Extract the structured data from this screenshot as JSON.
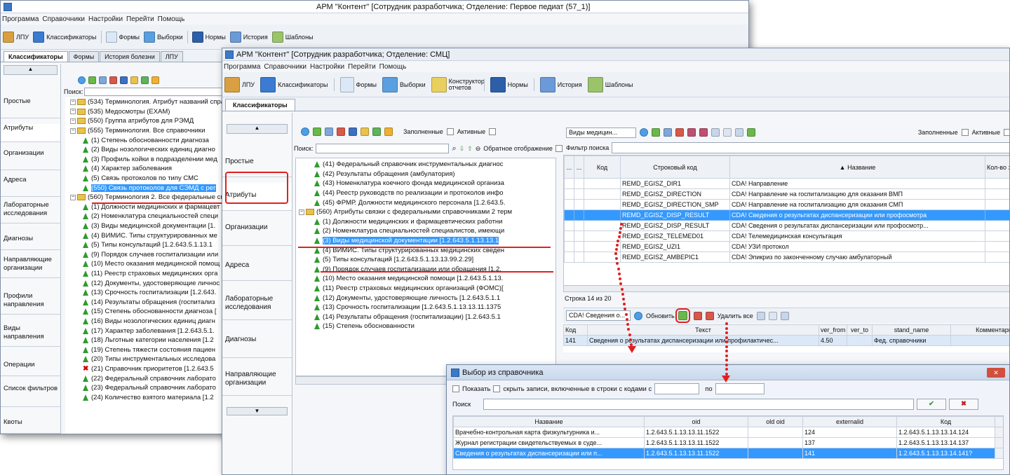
{
  "back_window": {
    "title": "АРМ \"Контент\" [Сотрудник разработчика; Отделение: Первое педиат (57_1)]",
    "menu": [
      "Программа",
      "Справочники",
      "Настройки",
      "Перейти",
      "Помощь"
    ],
    "toolbar": [
      "ЛПУ",
      "Классификаторы",
      "Формы",
      "Выборки",
      "Нормы",
      "История",
      "Шаблоны"
    ],
    "tabs": [
      "Классификаторы",
      "Формы",
      "История болезни",
      "ЛПУ"
    ],
    "search_label": "Поиск:",
    "sidebar": [
      "Простые",
      "Атрибуты",
      "Организации",
      "Адреса",
      "Лабораторные исследования",
      "Диагнозы",
      "Направляющие организации",
      "Профили направления",
      "Виды направления",
      "Операции",
      "Список фильтров",
      "Квоты"
    ],
    "tree": [
      {
        "t": "(534) Терминология. Атрибут названий спра",
        "k": "folder"
      },
      {
        "t": "(535) Медосмотры (EXAM)",
        "k": "folder"
      },
      {
        "t": "(550) Группа атрибутов для РЭМД",
        "k": "folder"
      },
      {
        "t": "(555) Терминология. Все справочники",
        "k": "folder"
      },
      {
        "t": "(1) Степень обоснованности диагноза",
        "k": "leaf"
      },
      {
        "t": "(2) Виды нозологических единиц диагно",
        "k": "leaf"
      },
      {
        "t": "(3) Профиль койки в подразделении мед",
        "k": "leaf"
      },
      {
        "t": "(4) Характер заболевания",
        "k": "leaf"
      },
      {
        "t": "(5) Связь протоколов по типу СМС",
        "k": "leaf"
      },
      {
        "t": "(550) Связь протоколов для СЭМД с рег",
        "k": "sel"
      },
      {
        "t": "(560) Терминология 2. Все федеральные спр",
        "k": "folder"
      },
      {
        "t": "(1) Должности медицинских и фармацевт",
        "k": "leaf"
      },
      {
        "t": "(2) Номенклатура специальностей специ",
        "k": "leaf"
      },
      {
        "t": "(3) Виды медицинской документации [1.",
        "k": "leaf"
      },
      {
        "t": "(4) ВИМИС. Типы структурированных ме",
        "k": "leaf"
      },
      {
        "t": "(5) Типы консультаций [1.2.643.5.1.13.1",
        "k": "leaf"
      },
      {
        "t": "(9) Порядок случаев госпитализации или",
        "k": "leaf"
      },
      {
        "t": "(10) Место оказания медицинской помощ",
        "k": "leaf"
      },
      {
        "t": "(11) Реестр страховых медицинских орга",
        "k": "leaf"
      },
      {
        "t": "(12) Документы, удостоверяющие личнос",
        "k": "leaf"
      },
      {
        "t": "(13) Срочность госпитализации [1.2.643.",
        "k": "leaf"
      },
      {
        "t": "(14) Результаты обращения (госпитализ",
        "k": "leaf"
      },
      {
        "t": "(15) Степень обоснованности диагноза [",
        "k": "leaf"
      },
      {
        "t": "(16) Виды нозологических единиц диагн",
        "k": "leaf"
      },
      {
        "t": "(17) Характер заболевания [1.2.643.5.1.",
        "k": "leaf"
      },
      {
        "t": "(18) Льготные категории населения [1.2",
        "k": "leaf"
      },
      {
        "t": "(19) Степень тяжести состояния пациен",
        "k": "leaf"
      },
      {
        "t": "(20) Типы инструментальных исследова",
        "k": "leaf"
      },
      {
        "t": "(21) Справочник приоритетов [1.2.643.5",
        "k": "red"
      },
      {
        "t": "(22) Федеральный справочник лаборато",
        "k": "leaf"
      },
      {
        "t": "(23) Федеральный справочник лаборато",
        "k": "leaf"
      },
      {
        "t": "(24) Количество взятого материала [1.2",
        "k": "leaf"
      }
    ]
  },
  "front_window": {
    "title": "АРМ \"Контент\" [Сотрудник разработчика; Отделение: СМЦ]",
    "menu": [
      "Программа",
      "Справочники",
      "Настройки",
      "Перейти",
      "Помощь"
    ],
    "toolbar": [
      "ЛПУ",
      "Классификаторы",
      "Формы",
      "Выборки",
      "Конструктор отчетов",
      "Нормы",
      "История",
      "Шаблоны"
    ],
    "tab": "Классификаторы",
    "sidebar": [
      "Простые",
      "Атрибуты",
      "Организации",
      "Адреса",
      "Лабораторные исследования",
      "Диагнозы",
      "Направляющие организации"
    ],
    "filled_label": "Заполненные",
    "active_label": "Активные",
    "search_label": "Поиск:",
    "reverse_label": "Обратное отображение",
    "tree": [
      {
        "t": "(41) Федеральный справочник инструментальных диагнос",
        "k": "leaf"
      },
      {
        "t": "(42) Результаты обращения (амбулатория)",
        "k": "leaf"
      },
      {
        "t": "(43) Номенклатура коечного фонда медицинской организа",
        "k": "leaf"
      },
      {
        "t": "(44) Реестр руководств по реализации и протоколов инфо",
        "k": "leaf"
      },
      {
        "t": "(45) ФРМР. Должности медицинского персонала [1.2.643.5.",
        "k": "leaf"
      },
      {
        "t": "(560) Атрибуты связки с федеральными справочниками 2 терм",
        "k": "folder"
      },
      {
        "t": "(1) Должности медицинских и фармацевтических работни",
        "k": "leaf"
      },
      {
        "t": "(2) Номенклатура специальностей специалистов, имеющи",
        "k": "leaf"
      },
      {
        "t": "(3) Виды медицинской документации [1.2.643.5.1.13.13.1",
        "k": "sel"
      },
      {
        "t": "(4) ВИМИС. Типы структурированных медицинских сведен",
        "k": "leaf"
      },
      {
        "t": "(5) Типы консультаций [1.2.643.5.1.13.13.99.2.29]",
        "k": "leaf"
      },
      {
        "t": "(9) Порядок случаев госпитализации или обращения [1.2.",
        "k": "leaf"
      },
      {
        "t": "(10) Место оказания медицинской помощи [1.2.643.5.1.13.",
        "k": "leaf"
      },
      {
        "t": "(11) Реестр страховых медицинских организаций (ФОМС)[",
        "k": "leaf"
      },
      {
        "t": "(12) Документы, удостоверяющие личность [1.2.643.5.1.1",
        "k": "leaf"
      },
      {
        "t": "(13) Срочность госпитализации [1.2.643.5.1.13.13.11.1375",
        "k": "leaf"
      },
      {
        "t": "(14) Результаты обращения (госпитализации) [1.2.643.5.1",
        "k": "leaf"
      },
      {
        "t": "(15) Степень обоснованности",
        "k": "leaf"
      }
    ],
    "right_combo": "Виды медицин...",
    "filter_label": "Фильтр поиска",
    "grid_headers": [
      "...",
      "...",
      "Код",
      "Строковый код",
      "▲ Название",
      "Кол-во записей"
    ],
    "grid_rows": [
      {
        "code": "",
        "str": "REMD_EGISZ_DIR1",
        "name": "CDA! Направление",
        "sel": false
      },
      {
        "code": "",
        "str": "REMD_EGISZ_DIRECTION",
        "name": "CDA! Направление на госпитализацию для оказания ВМП",
        "sel": false
      },
      {
        "code": "",
        "str": "REMD_EGISZ_DIRECTION_SMP",
        "name": "CDA! Направление на госпитализацию для оказания СМП",
        "sel": false
      },
      {
        "code": "",
        "str": "REMD_EGISZ_DISP_RESULT",
        "name": "CDA! Сведения о результатах диспансеризации или профосмотра",
        "sel": true
      },
      {
        "code": "",
        "str": "REMD_EGISZ_DISP_RESULT",
        "name": "CDA! Сведения о результатах диспансеризации или профосмотр...",
        "sel": false
      },
      {
        "code": "",
        "str": "REMD_EGISZ_TELEMED01",
        "name": "CDA! Телемедицинская консультация",
        "sel": false
      },
      {
        "code": "",
        "str": "REMD_EGISZ_UZI1",
        "name": "CDA! УЗИ протокол",
        "sel": false
      },
      {
        "code": "",
        "str": "REMD_EGISZ_AMBEPIC1",
        "name": "CDA! Эпикриз по законченному случаю амбулаторный",
        "sel": false
      }
    ],
    "row_status": "Строка 14 из 20",
    "bottom_combo": "CDA! Сведения о...",
    "refresh_label": "Обновить",
    "delete_all_label": "Удалить все",
    "sub_headers": [
      "Код",
      "Текст",
      "ver_from",
      "ver_to",
      "stand_name",
      "Комментарий"
    ],
    "sub_rows": [
      {
        "code": "141",
        "text": "Сведения о результатах диспансеризации или профилактичес...",
        "ver_from": "4.50",
        "ver_to": "",
        "stand": "Фед. справочники",
        "comment": ""
      }
    ]
  },
  "dialog": {
    "title": "Выбор из справочника",
    "show_label": "Показать",
    "hide_label": "скрыть записи, включенные в строки с кодами с",
    "to_label": "по",
    "search_label": "Поиск",
    "headers": [
      "Название",
      "oid",
      "old oid",
      "externalid",
      "Код"
    ],
    "rows": [
      {
        "name": "Врачебно-контрольная карта физкультурника и...",
        "oid": "1.2.643.5.1.13.13.11.1522",
        "old": "",
        "ext": "124",
        "code": "1.2.643.5.1.13.13.14.124",
        "sel": false
      },
      {
        "name": "Журнал регистрации свидетельствуемых в суде...",
        "oid": "1.2.643.5.1.13.13.11.1522",
        "old": "",
        "ext": "137",
        "code": "1.2.643.5.1.13.13.14.137",
        "sel": false
      },
      {
        "name": "Сведения о результатах диспансеризации или п...",
        "oid": "1.2.643.5.1.13.13.11.1522",
        "old": "",
        "ext": "141",
        "code": "1.2.643.5.1.13.13.14.141?",
        "sel": true
      }
    ]
  }
}
